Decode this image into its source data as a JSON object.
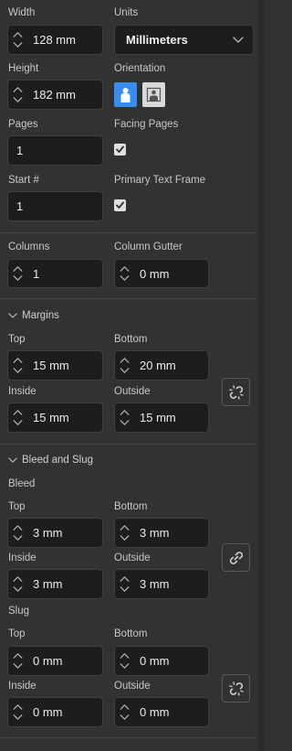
{
  "page": {
    "width_label": "Width",
    "width_value": "128 mm",
    "units_label": "Units",
    "units_value": "Millimeters",
    "height_label": "Height",
    "height_value": "182 mm",
    "orientation_label": "Orientation",
    "pages_label": "Pages",
    "pages_value": "1",
    "facing_label": "Facing Pages",
    "facing_checked": true,
    "start_label": "Start #",
    "start_value": "1",
    "primary_label": "Primary Text Frame",
    "primary_checked": true
  },
  "columns": {
    "columns_label": "Columns",
    "columns_value": "1",
    "gutter_label": "Column Gutter",
    "gutter_value": "0 mm"
  },
  "margins": {
    "title": "Margins",
    "top_label": "Top",
    "top_value": "15 mm",
    "bottom_label": "Bottom",
    "bottom_value": "20 mm",
    "inside_label": "Inside",
    "inside_value": "15 mm",
    "outside_label": "Outside",
    "outside_value": "15 mm",
    "linked": false
  },
  "bleed_slug": {
    "title": "Bleed and Slug",
    "bleed": {
      "title": "Bleed",
      "top_label": "Top",
      "top_value": "3 mm",
      "bottom_label": "Bottom",
      "bottom_value": "3 mm",
      "inside_label": "Inside",
      "inside_value": "3 mm",
      "outside_label": "Outside",
      "outside_value": "3 mm",
      "linked": true
    },
    "slug": {
      "title": "Slug",
      "top_label": "Top",
      "top_value": "0 mm",
      "bottom_label": "Bottom",
      "bottom_value": "0 mm",
      "inside_label": "Inside",
      "inside_value": "0 mm",
      "outside_label": "Outside",
      "outside_value": "0 mm",
      "linked": false
    }
  },
  "icons": {
    "stepper": "chevron-up-down-icon",
    "dropdown": "chevron-down-icon",
    "section": "chevron-down-icon",
    "portrait": "portrait-person-icon",
    "landscape": "landscape-person-icon",
    "link": "chain-link-icon",
    "unlink": "broken-chain-icon",
    "check": "checkmark-icon"
  },
  "colors": {
    "panel_bg": "#323232",
    "field_bg": "#1d1d1d",
    "accent_blue": "#378ef0",
    "text": "#ececec"
  }
}
